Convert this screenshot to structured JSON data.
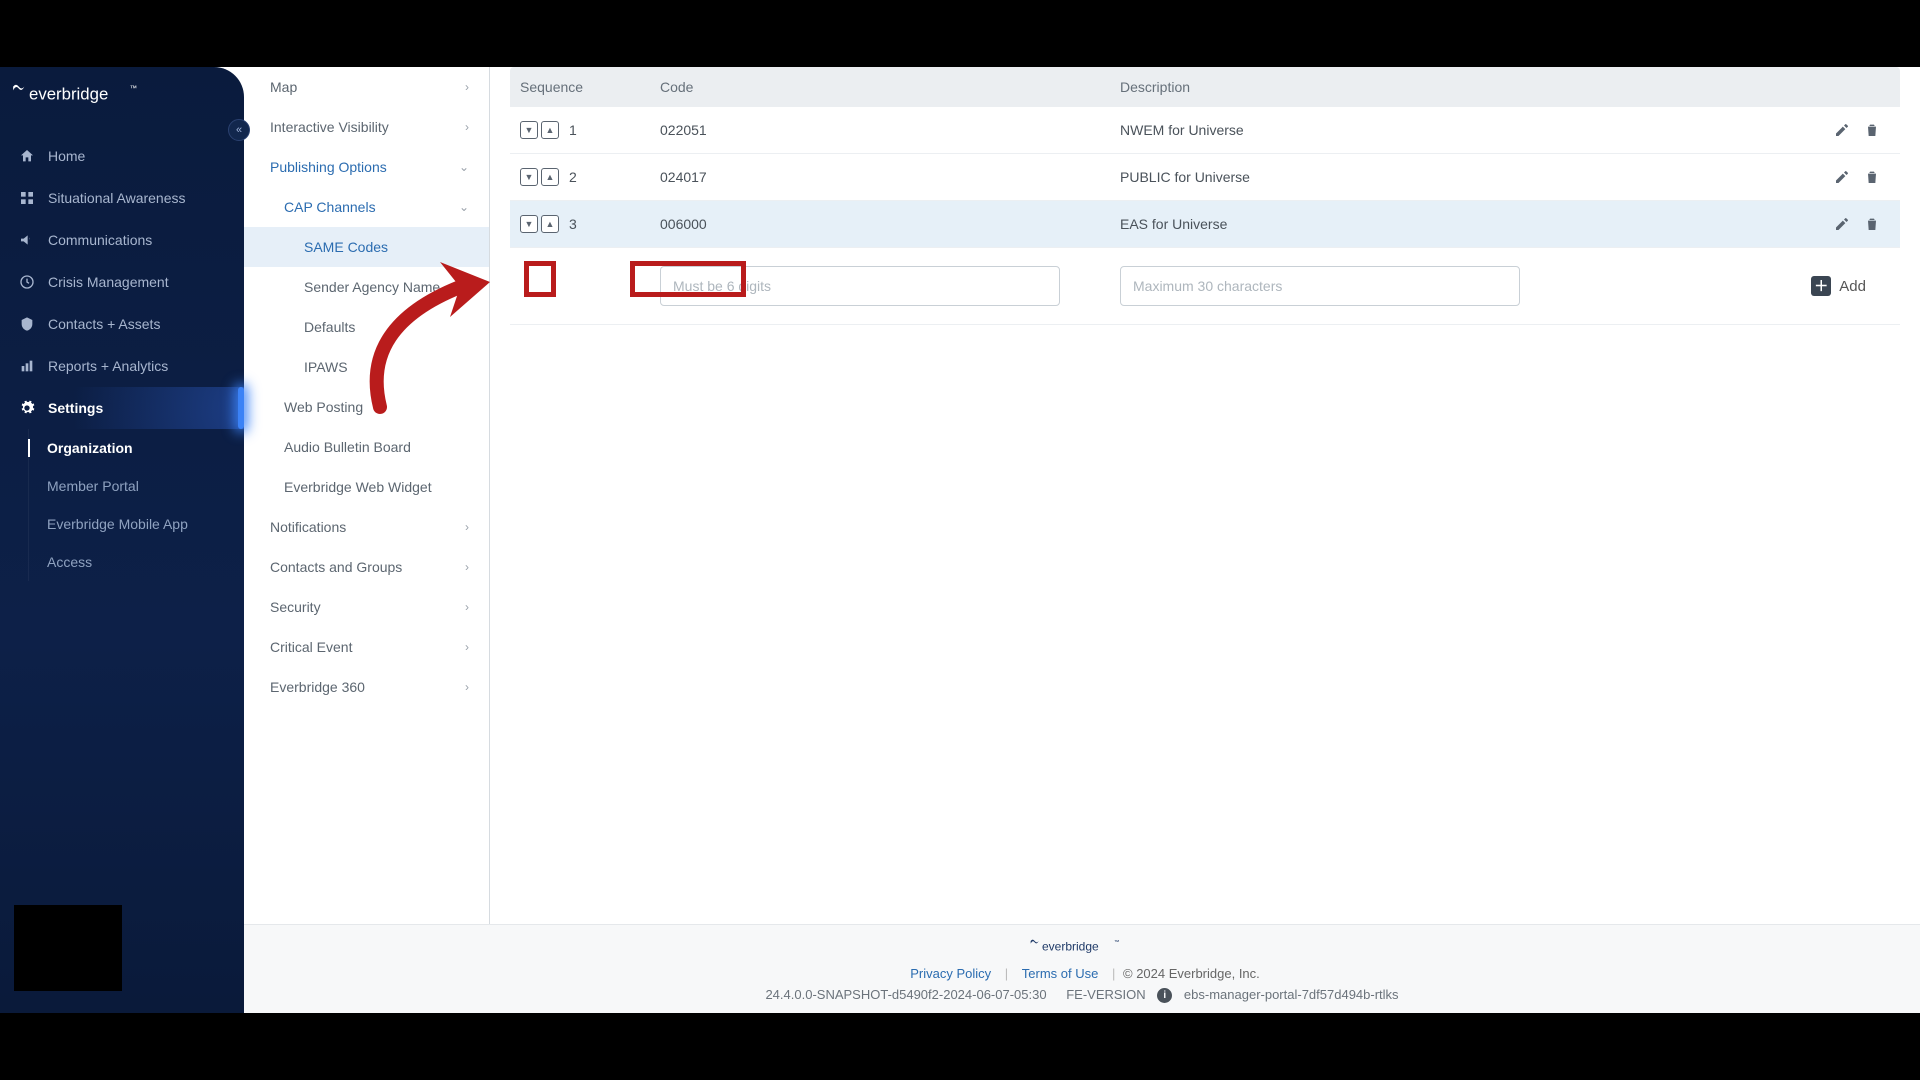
{
  "brand": "everbridge",
  "collapse_glyph": "«",
  "left_nav": [
    {
      "icon": "home",
      "label": "Home"
    },
    {
      "icon": "map-pin",
      "label": "Situational Awareness"
    },
    {
      "icon": "bullhorn",
      "label": "Communications"
    },
    {
      "icon": "clock",
      "label": "Crisis Management"
    },
    {
      "icon": "shield",
      "label": "Contacts + Assets"
    },
    {
      "icon": "chart",
      "label": "Reports + Analytics"
    },
    {
      "icon": "gear",
      "label": "Settings",
      "active": true
    }
  ],
  "settings_sub": [
    {
      "label": "Organization",
      "active": true
    },
    {
      "label": "Member Portal"
    },
    {
      "label": "Everbridge Mobile App"
    },
    {
      "label": "Access"
    }
  ],
  "sub_sidebar": {
    "items": [
      {
        "label": "Map",
        "chev": "right"
      },
      {
        "label": "Interactive Visibility",
        "chev": "right"
      },
      {
        "label": "Publishing Options",
        "chev": "down",
        "blue": true
      },
      {
        "label": "CAP Channels",
        "chev": "down",
        "blue": true,
        "indent": 1
      },
      {
        "label": "SAME Codes",
        "indent": 2,
        "selected": true
      },
      {
        "label": "Sender Agency Name",
        "indent": 2
      },
      {
        "label": "Defaults",
        "indent": 2
      },
      {
        "label": "IPAWS",
        "indent": 2
      },
      {
        "label": "Web Posting",
        "indent": 1
      },
      {
        "label": "Audio Bulletin Board",
        "indent": 1
      },
      {
        "label": "Everbridge Web Widget",
        "indent": 1
      },
      {
        "label": "Notifications",
        "chev": "right"
      },
      {
        "label": "Contacts and Groups",
        "chev": "right"
      },
      {
        "label": "Security",
        "chev": "right"
      },
      {
        "label": "Critical Event",
        "chev": "right"
      },
      {
        "label": "Everbridge 360",
        "chev": "right"
      }
    ]
  },
  "table": {
    "headers": {
      "sequence": "Sequence",
      "code": "Code",
      "description": "Description"
    },
    "rows": [
      {
        "seq": "1",
        "code": "022051",
        "desc": "NWEM for Universe"
      },
      {
        "seq": "2",
        "code": "024017",
        "desc": "PUBLIC for Universe"
      },
      {
        "seq": "3",
        "code": "006000",
        "desc": "EAS for Universe",
        "highlight": true
      }
    ],
    "code_placeholder": "Must be 6 digits",
    "desc_placeholder": "Maximum 30 characters",
    "add_label": "Add"
  },
  "footer": {
    "privacy": "Privacy Policy",
    "terms": "Terms of Use",
    "copyright": "© 2024 Everbridge, Inc.",
    "version": "24.4.0.0-SNAPSHOT-d5490f2-2024-06-07-05:30",
    "fe": "FE-VERSION",
    "portal": "ebs-manager-portal-7df57d494b-rtlks"
  }
}
